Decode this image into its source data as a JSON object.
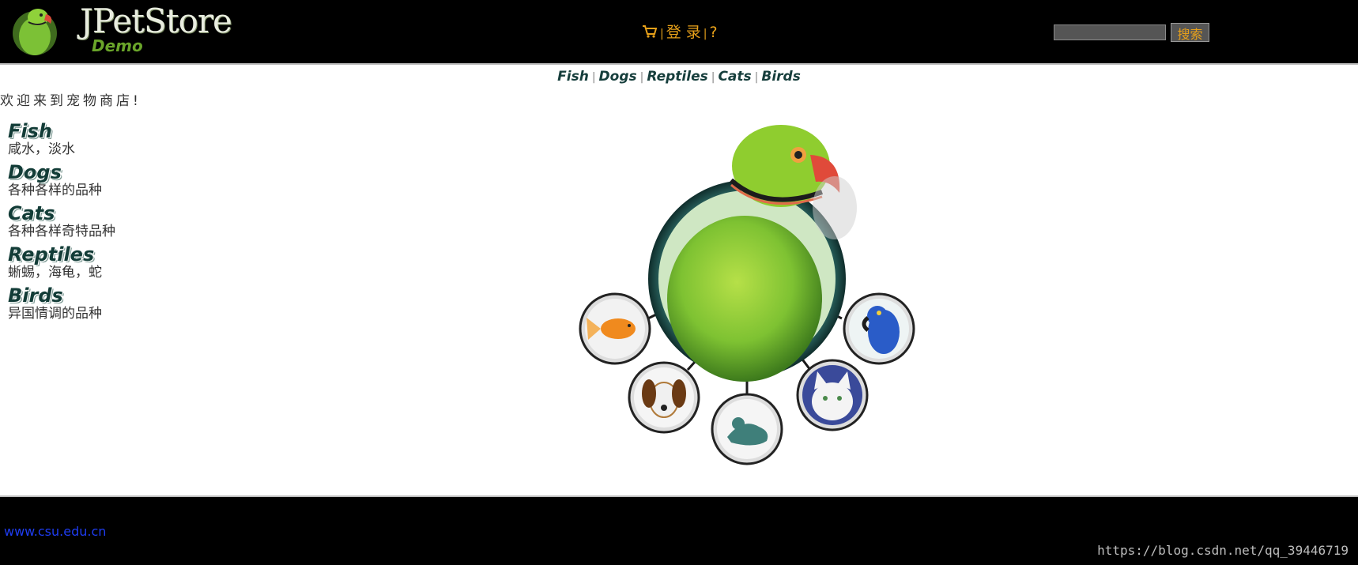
{
  "header": {
    "logo_title": "JPetStore",
    "logo_subtitle": "Demo",
    "menu": {
      "login": "登 录",
      "help": "?"
    },
    "search": {
      "value": "",
      "button_label": "搜索"
    }
  },
  "quick_links": [
    "Fish",
    "Dogs",
    "Reptiles",
    "Cats",
    "Birds"
  ],
  "welcome": "欢迎来到宠物商店!",
  "categories": [
    {
      "name": "Fish",
      "desc": "咸水，淡水"
    },
    {
      "name": "Dogs",
      "desc": "各种各样的品种"
    },
    {
      "name": "Cats",
      "desc": "各种各样奇特品种"
    },
    {
      "name": "Reptiles",
      "desc": "蜥蜴，海龟，蛇"
    },
    {
      "name": "Birds",
      "desc": "异国情调的品种"
    }
  ],
  "footer": {
    "link": "www.csu.edu.cn",
    "watermark": "https://blog.csdn.net/qq_39446719"
  },
  "colors": {
    "menu": "#e8a11a",
    "header_bg": "#000000",
    "link_blue": "#1e3cf0",
    "title_dark": "#123c37"
  }
}
